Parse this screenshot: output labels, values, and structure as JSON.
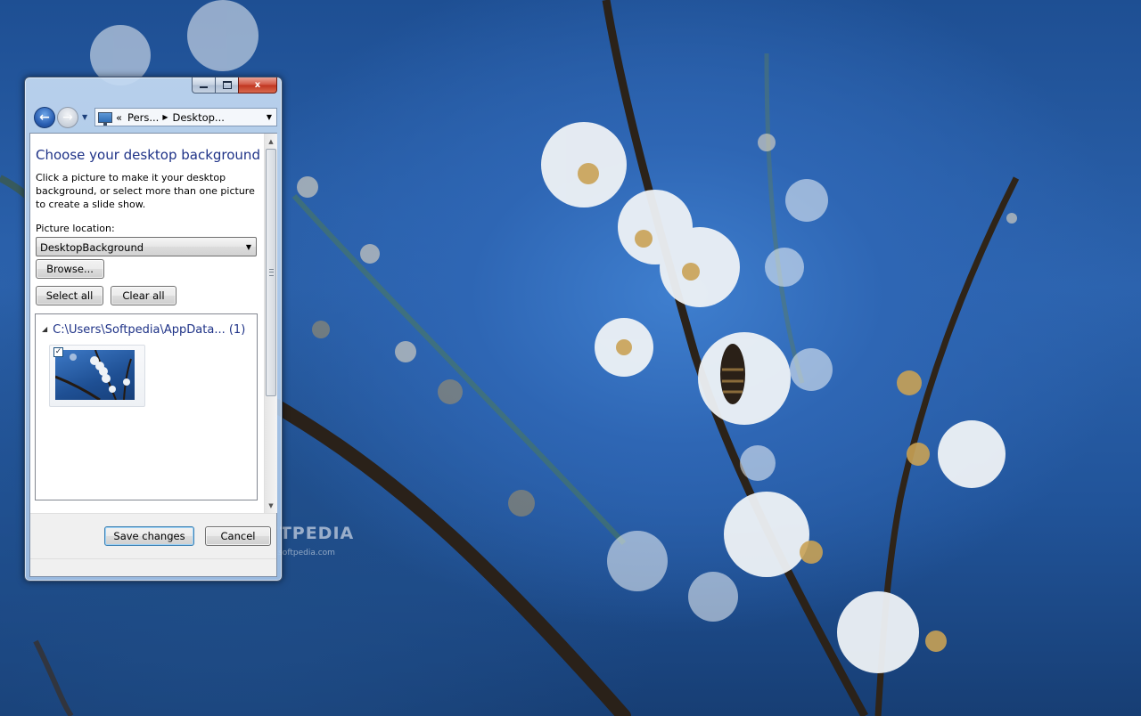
{
  "window": {
    "caption_buttons": {
      "minimize_icon": "minimize-icon",
      "maximize_icon": "maximize-icon",
      "close_icon": "close-icon",
      "close_glyph": "x"
    },
    "nav": {
      "back_glyph": "←",
      "forward_glyph": "→",
      "recent_glyph": "▼",
      "address": {
        "icon": "control-panel-icon",
        "overflow_glyph": "«",
        "crumbs": [
          "Pers...",
          "Desktop..."
        ],
        "separator_glyph": "▶",
        "dropdown_glyph": "▼"
      }
    },
    "content": {
      "title": "Choose your desktop background",
      "description": "Click a picture to make it your desktop background, or select more than one picture to create a slide show.",
      "picture_location_label": "Picture location:",
      "picture_location_value": "DesktopBackground",
      "dropdown_glyph": "▼",
      "browse_label": "Browse...",
      "select_all_label": "Select all",
      "clear_all_label": "Clear all",
      "group": {
        "collapse_glyph": "◢",
        "header": "C:\\Users\\Softpedia\\AppData... (1)",
        "items": [
          {
            "checked": true,
            "check_glyph": "✓",
            "thumbnail": "blossom-thumbnail"
          }
        ]
      }
    },
    "scrollbar": {
      "up_glyph": "▲",
      "down_glyph": "▼"
    },
    "footer": {
      "save_label": "Save changes",
      "cancel_label": "Cancel"
    }
  },
  "watermark": {
    "text": "SOFTPEDIA",
    "url": "www.softpedia.com"
  },
  "colors": {
    "title_blue": "#1e3287",
    "desktop_blue": "#2c63ae",
    "close_red": "#c0341f"
  }
}
